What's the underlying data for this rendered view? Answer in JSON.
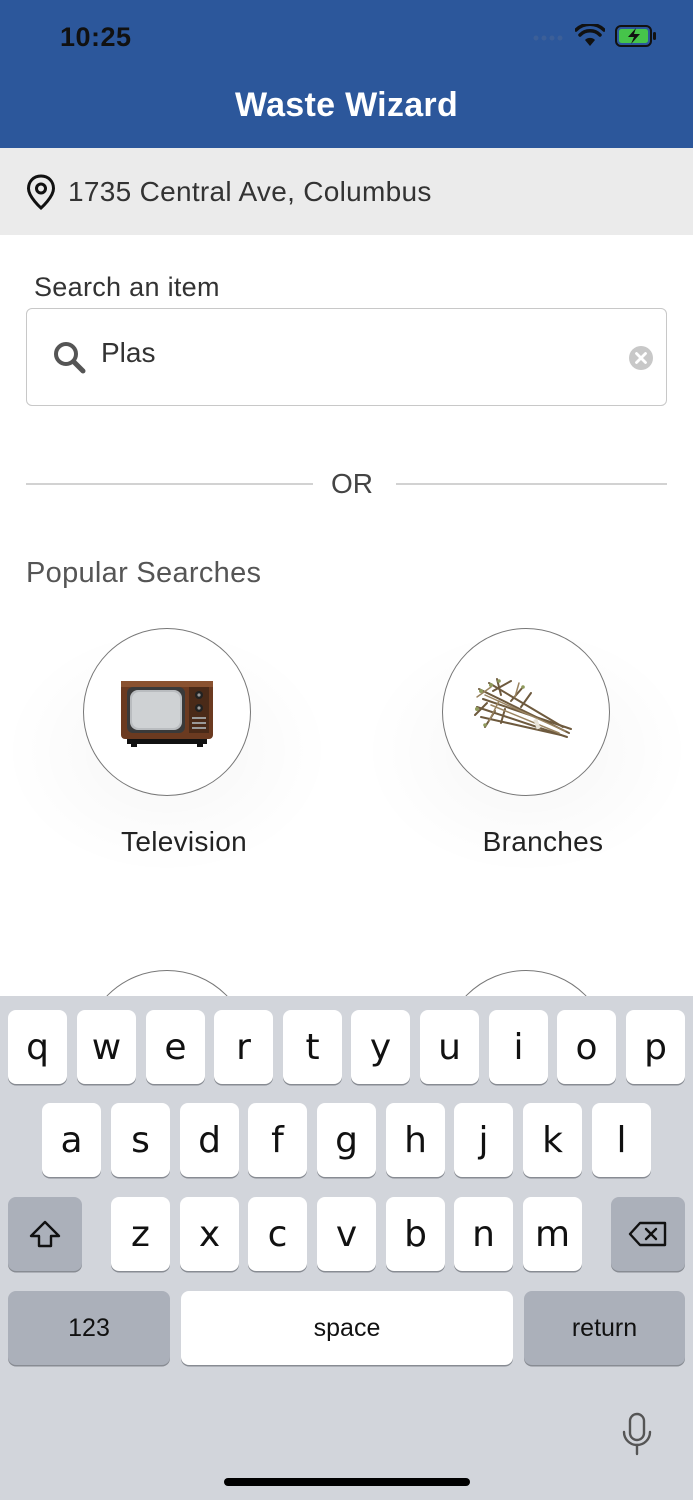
{
  "status_bar": {
    "time": "10:25"
  },
  "header": {
    "title": "Waste Wizard"
  },
  "location": {
    "address": "1735 Central Ave, Columbus"
  },
  "search": {
    "label": "Search an item",
    "value": "Plas"
  },
  "divider": {
    "text": "OR"
  },
  "popular": {
    "title": "Popular Searches",
    "items": [
      {
        "label": "Television",
        "icon": "television-image"
      },
      {
        "label": "Branches",
        "icon": "branches-image"
      }
    ]
  },
  "keyboard": {
    "row1": [
      "q",
      "w",
      "e",
      "r",
      "t",
      "y",
      "u",
      "i",
      "o",
      "p"
    ],
    "row2": [
      "a",
      "s",
      "d",
      "f",
      "g",
      "h",
      "j",
      "k",
      "l"
    ],
    "row3": [
      "z",
      "x",
      "c",
      "v",
      "b",
      "n",
      "m"
    ],
    "numbers_label": "123",
    "space_label": "space",
    "return_label": "return"
  },
  "colors": {
    "header": "#2c579b",
    "location_bar": "#ebebeb",
    "keyboard_bg": "#d2d5db"
  }
}
